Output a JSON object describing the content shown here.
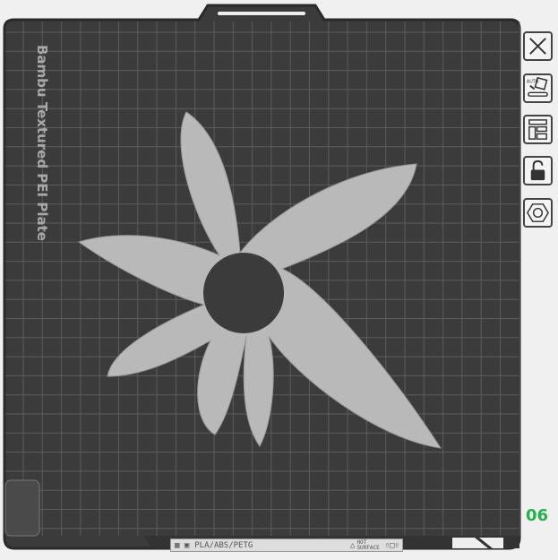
{
  "plate": {
    "name": "Bambu Textured PEI Plate",
    "number": "06"
  },
  "bottom_bar": {
    "filaments": "PLA/ABS/PETG",
    "warning_line1": "HOT",
    "warning_line2": "SURFACE"
  },
  "toolbar": [
    {
      "name": "close-plate",
      "icon": "close-icon"
    },
    {
      "name": "auto-orient",
      "icon": "auto-orient-icon",
      "label": "AUTO"
    },
    {
      "name": "arrange",
      "icon": "arrange-icon"
    },
    {
      "name": "lock-plate",
      "icon": "unlock-icon"
    },
    {
      "name": "plate-settings",
      "icon": "hex-settings-icon"
    }
  ],
  "colors": {
    "plate": "#3b3b3b",
    "grid": "#5a5a5a",
    "model": "#b8b8b8",
    "accent": "#22b14c"
  }
}
